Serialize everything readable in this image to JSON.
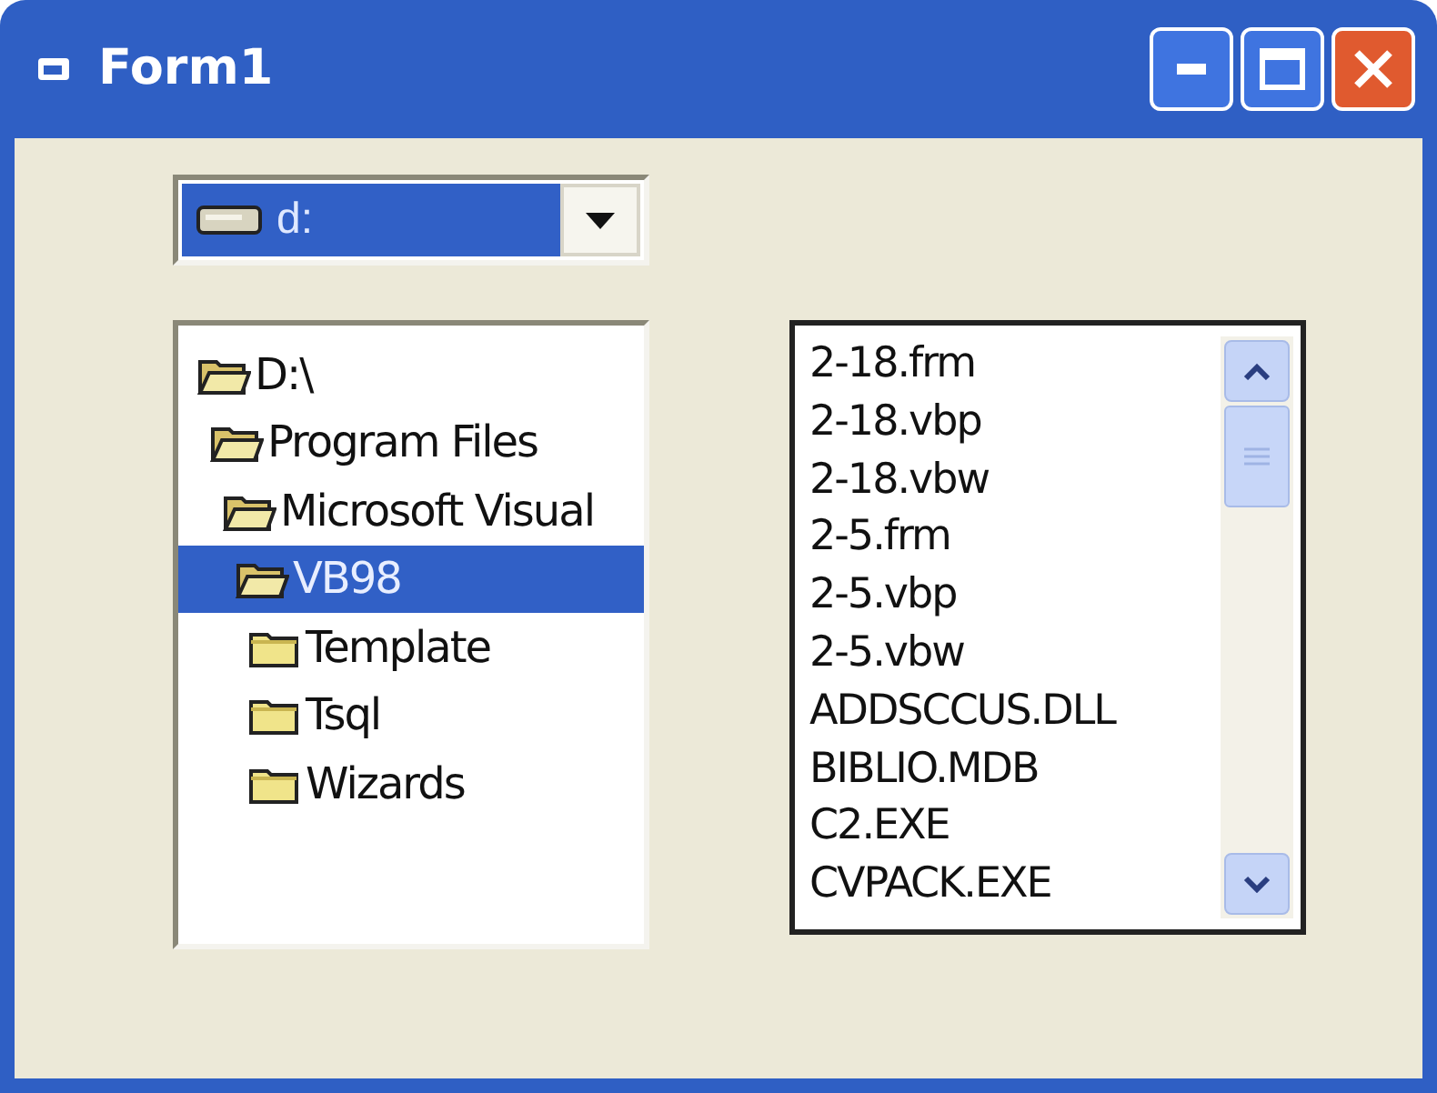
{
  "window": {
    "title": "Form1"
  },
  "drive_combo": {
    "value": "d:",
    "selected": true
  },
  "directory_tree": [
    {
      "label": "D:\\",
      "expanded": true,
      "selected": false,
      "children": [
        {
          "label": "Program Files",
          "expanded": true,
          "selected": false,
          "children": [
            {
              "label": "Microsoft Visual",
              "expanded": true,
              "selected": false,
              "children": [
                {
                  "label": "VB98",
                  "expanded": true,
                  "selected": true,
                  "children": [
                    {
                      "label": "Template",
                      "expanded": false,
                      "selected": false
                    },
                    {
                      "label": "Tsql",
                      "expanded": false,
                      "selected": false
                    },
                    {
                      "label": "Wizards",
                      "expanded": false,
                      "selected": false
                    }
                  ]
                }
              ]
            }
          ]
        }
      ]
    }
  ],
  "file_list": {
    "items": [
      "2-18.frm",
      "2-18.vbp",
      "2-18.vbw",
      "2-5.frm",
      "2-5.vbp",
      "2-5.vbw",
      "ADDSCCUS.DLL",
      "BIBLIO.MDB",
      "C2.EXE",
      "CVPACK.EXE"
    ]
  }
}
